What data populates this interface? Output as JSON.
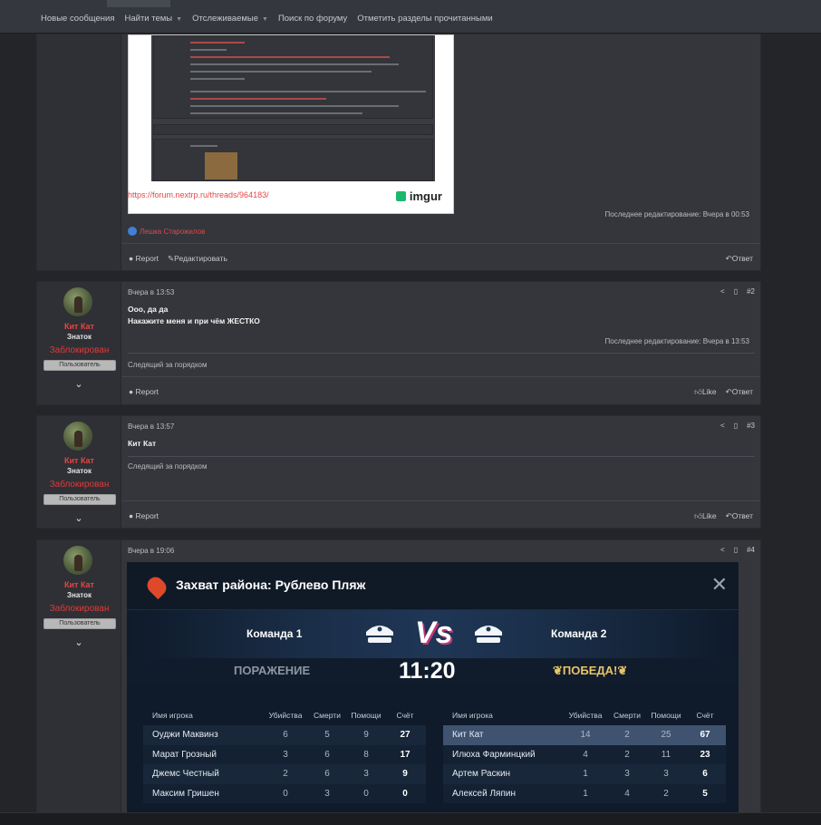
{
  "nav": {
    "items": [
      "Новые сообщения",
      "Найти темы",
      "Отслеживаемые",
      "Поиск по форуму",
      "Отметить разделы прочитанными"
    ]
  },
  "post1": {
    "link": "https://forum.nextrp.ru/threads/964183/",
    "edited": "Последнее редактирование: Вчера в 00:53",
    "reaction_user": "Лешка Старожилов",
    "image_logo": "imgur",
    "actions": {
      "report": "Report",
      "edit": "Редактировать",
      "reply": "Ответ"
    }
  },
  "post2": {
    "date": "Вчера в 13:53",
    "num": "#2",
    "user": {
      "name": "Кит Кат",
      "title": "Знаток",
      "status": "Заблокирован",
      "badge": "Пользователь"
    },
    "lines": [
      "Ооо, да да",
      "Накажите меня и при чём ЖЕСТКО"
    ],
    "edited": "Последнее редактирование: Вчера в 13:53",
    "signature": "Следящий за порядком",
    "actions": {
      "report": "Report",
      "like": "Like",
      "reply": "Ответ"
    }
  },
  "post3": {
    "date": "Вчера в 13:57",
    "num": "#3",
    "user": {
      "name": "Кит Кат",
      "title": "Знаток",
      "status": "Заблокирован",
      "badge": "Пользователь"
    },
    "lines": [
      "Кит Кат"
    ],
    "signature": "Следящий за порядком",
    "actions": {
      "report": "Report",
      "like": "Like",
      "reply": "Ответ"
    }
  },
  "post4": {
    "date": "Вчера в 19:06",
    "num": "#4",
    "user": {
      "name": "Кит Кат",
      "title": "Знаток",
      "status": "Заблокирован",
      "badge": "Пользователь"
    }
  },
  "game": {
    "title": "Захват района: Рублево Пляж",
    "team1": "Команда 1",
    "team2": "Команда 2",
    "vs": "Vs",
    "result_left": "ПОРАЖЕНИЕ",
    "result_right": "ПОБЕДА!",
    "time": "11:20",
    "columns": [
      "Имя игрока",
      "Убийства",
      "Смерти",
      "Помощи",
      "Счёт"
    ],
    "left": [
      {
        "name": "Оуджи Маквинз",
        "k": "6",
        "d": "5",
        "a": "9",
        "s": "27"
      },
      {
        "name": "Марат Грозный",
        "k": "3",
        "d": "6",
        "a": "8",
        "s": "17"
      },
      {
        "name": "Джемс Честный",
        "k": "2",
        "d": "6",
        "a": "3",
        "s": "9"
      },
      {
        "name": "Максим Гришен",
        "k": "0",
        "d": "3",
        "a": "0",
        "s": "0"
      }
    ],
    "right": [
      {
        "name": "Кит Кат",
        "k": "14",
        "d": "2",
        "a": "25",
        "s": "67"
      },
      {
        "name": "Илюха Фарминцкий",
        "k": "4",
        "d": "2",
        "a": "11",
        "s": "23"
      },
      {
        "name": "Артем Раскин",
        "k": "1",
        "d": "3",
        "a": "3",
        "s": "6"
      },
      {
        "name": "Алексей Ляпин",
        "k": "1",
        "d": "4",
        "a": "2",
        "s": "5"
      }
    ]
  }
}
